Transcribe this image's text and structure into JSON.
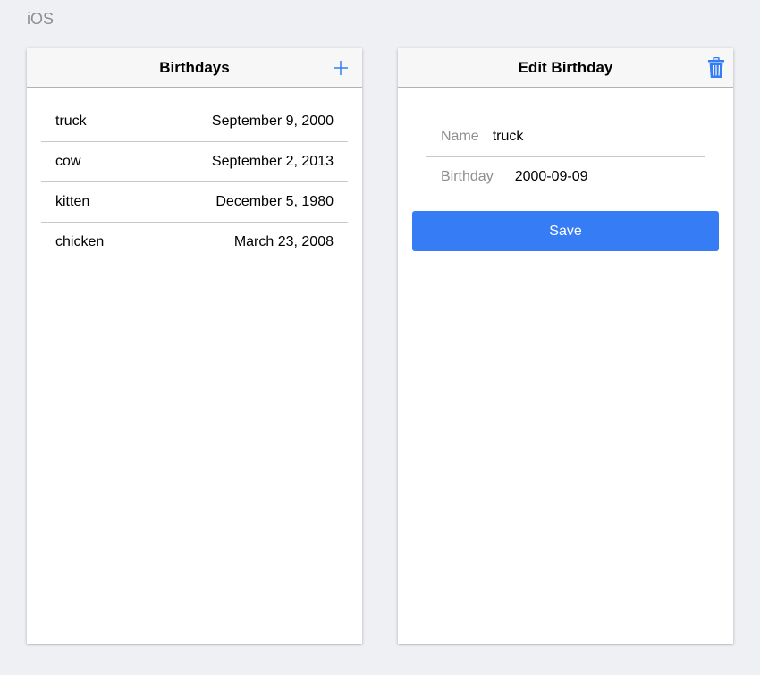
{
  "platform": "iOS",
  "list_screen": {
    "title": "Birthdays",
    "add_icon": "plus-icon",
    "items": [
      {
        "name": "truck",
        "date": "September 9, 2000"
      },
      {
        "name": "cow",
        "date": "September 2, 2013"
      },
      {
        "name": "kitten",
        "date": "December 5, 1980"
      },
      {
        "name": "chicken",
        "date": "March 23, 2008"
      }
    ]
  },
  "edit_screen": {
    "title": "Edit Birthday",
    "delete_icon": "trash-icon",
    "name_label": "Name",
    "name_value": "truck",
    "birthday_label": "Birthday",
    "birthday_value": "2000-09-09",
    "save_label": "Save"
  },
  "colors": {
    "background": "#eff0f4",
    "accent": "#357cf5",
    "separator": "#c8c7cc",
    "label_gray": "#8e8e93"
  }
}
